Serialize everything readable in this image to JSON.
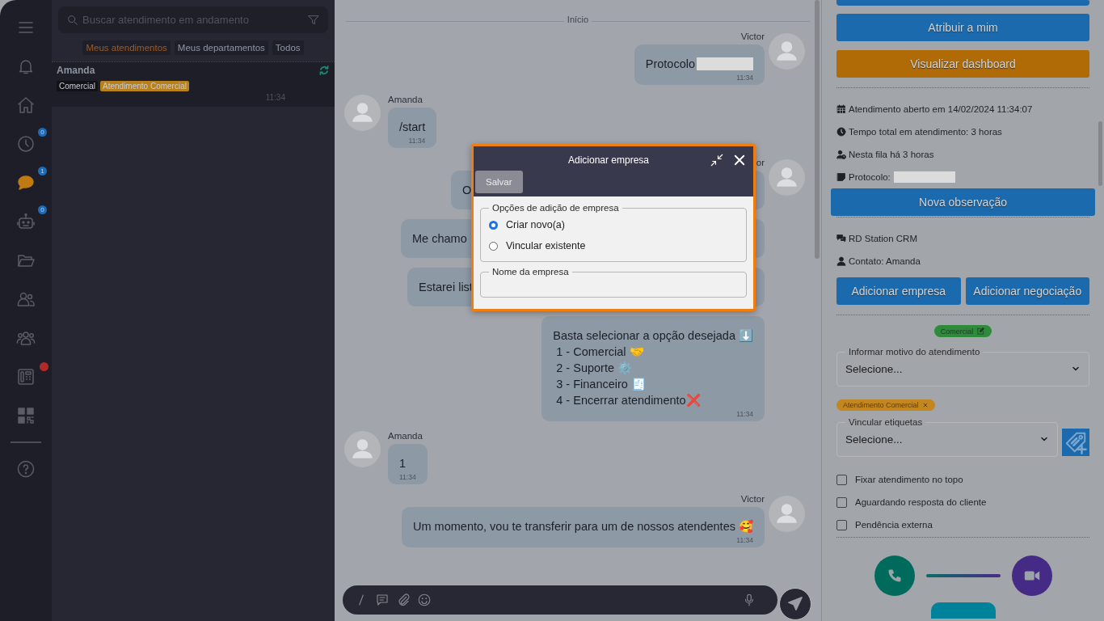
{
  "sidebar": {
    "items": [
      {
        "kind": "menu",
        "selected": false
      },
      {
        "kind": "bell",
        "selected": false
      },
      {
        "kind": "home",
        "selected": false
      },
      {
        "kind": "clock",
        "selected": false,
        "badge": "0"
      },
      {
        "kind": "chat",
        "selected": true,
        "badge": "1"
      },
      {
        "kind": "robot",
        "selected": false,
        "badge": "0"
      },
      {
        "kind": "folder",
        "selected": false
      },
      {
        "kind": "users",
        "selected": false
      },
      {
        "kind": "group",
        "selected": false
      },
      {
        "kind": "phone",
        "selected": false,
        "alert": true
      },
      {
        "kind": "qr",
        "selected": false
      },
      {
        "kind": "help",
        "selected": false
      }
    ]
  },
  "conversation_list": {
    "search": {
      "placeholder": "Buscar atendimento em andamento"
    },
    "filters": [
      {
        "label": "Meus atendimentos",
        "selected": true
      },
      {
        "label": "Meus departamentos",
        "selected": false
      },
      {
        "label": "Todos",
        "selected": false
      }
    ],
    "conversations": [
      {
        "name": "Amanda",
        "time": "11:34",
        "tags": [
          {
            "label": "Comercial",
            "color": "#111217"
          },
          {
            "label": "Atendimento Comercial",
            "color": "#b8811c"
          }
        ]
      }
    ]
  },
  "chat": {
    "divider": "Início",
    "messages": [
      {
        "kind": "outgoing",
        "sender": "Victor",
        "lines": [
          "Protocolo"
        ],
        "redacted": true,
        "time": "11:34"
      },
      {
        "kind": "incoming",
        "sender": "Amanda",
        "lines": [
          "/start"
        ],
        "time": "11:34"
      },
      {
        "kind": "outgoing",
        "sender": "or",
        "lines": [
          "O"
        ],
        "covered": true
      },
      {
        "kind": "outgoing",
        "lines": [
          "Me chamo"
        ],
        "covered": true
      },
      {
        "kind": "outgoing",
        "lines": [
          "Estarei list"
        ],
        "covered": true
      },
      {
        "kind": "outgoing",
        "lines": [
          "Basta selecionar a opção desejada ⬇️",
          " 1 - Comercial 🤝",
          " 2 - Suporte ⚙️",
          " 3 - Financeiro 🧾",
          " 4 - Encerrar atendimento❌"
        ],
        "time": "11:34"
      },
      {
        "kind": "incoming",
        "sender": "Amanda",
        "lines": [
          "1"
        ],
        "time": "11:34"
      },
      {
        "kind": "outgoing",
        "sender": "Victor",
        "lines": [
          "Um momento, vou te transferir para um de nossos atendentes 🥰"
        ],
        "time": "11:34"
      }
    ]
  },
  "dialog": {
    "title": "Adicionar empresa",
    "save": "Salvar",
    "options_legend": "Opções de adição de empresa",
    "options": [
      {
        "label": "Criar novo(a)",
        "selected": true
      },
      {
        "label": "Vincular existente",
        "selected": false
      }
    ],
    "name_legend": "Nome da empresa"
  },
  "details": {
    "buttons": [
      {
        "label": "Atribuir a mim",
        "kind": "blue"
      },
      {
        "label": "Visualizar dashboard",
        "kind": "orange"
      }
    ],
    "info": [
      {
        "kind": "calendar",
        "text": "Atendimento aberto em 14/02/2024 11:34:07"
      },
      {
        "kind": "clock",
        "text": "Tempo total em atendimento: 3 horas"
      },
      {
        "kind": "queue",
        "text": "Nesta fila há 3 horas"
      },
      {
        "kind": "note",
        "text": "Protocolo:",
        "redacted": true
      }
    ],
    "note_button": "Nova observação",
    "crm": {
      "title": "RD Station CRM",
      "contact": "Contato: Amanda",
      "buttons": [
        "Adicionar empresa",
        "Adicionar negociação"
      ]
    },
    "department_tag": {
      "label": "Comercial",
      "color": "#2f8a3c"
    },
    "reason": {
      "legend": "Informar motivo do atendimento",
      "value": "Selecione..."
    },
    "labels": [
      {
        "label": "Atendimento Comercial",
        "color": "#c4861f"
      }
    ],
    "labels_select": {
      "legend": "Vincular etiquetas",
      "value": "Selecione..."
    },
    "checkboxes": [
      {
        "label": "Fixar atendimento no topo",
        "checked": false
      },
      {
        "label": "Aguardando resposta do cliente",
        "checked": false
      },
      {
        "label": "Pendência externa",
        "checked": false
      }
    ]
  }
}
